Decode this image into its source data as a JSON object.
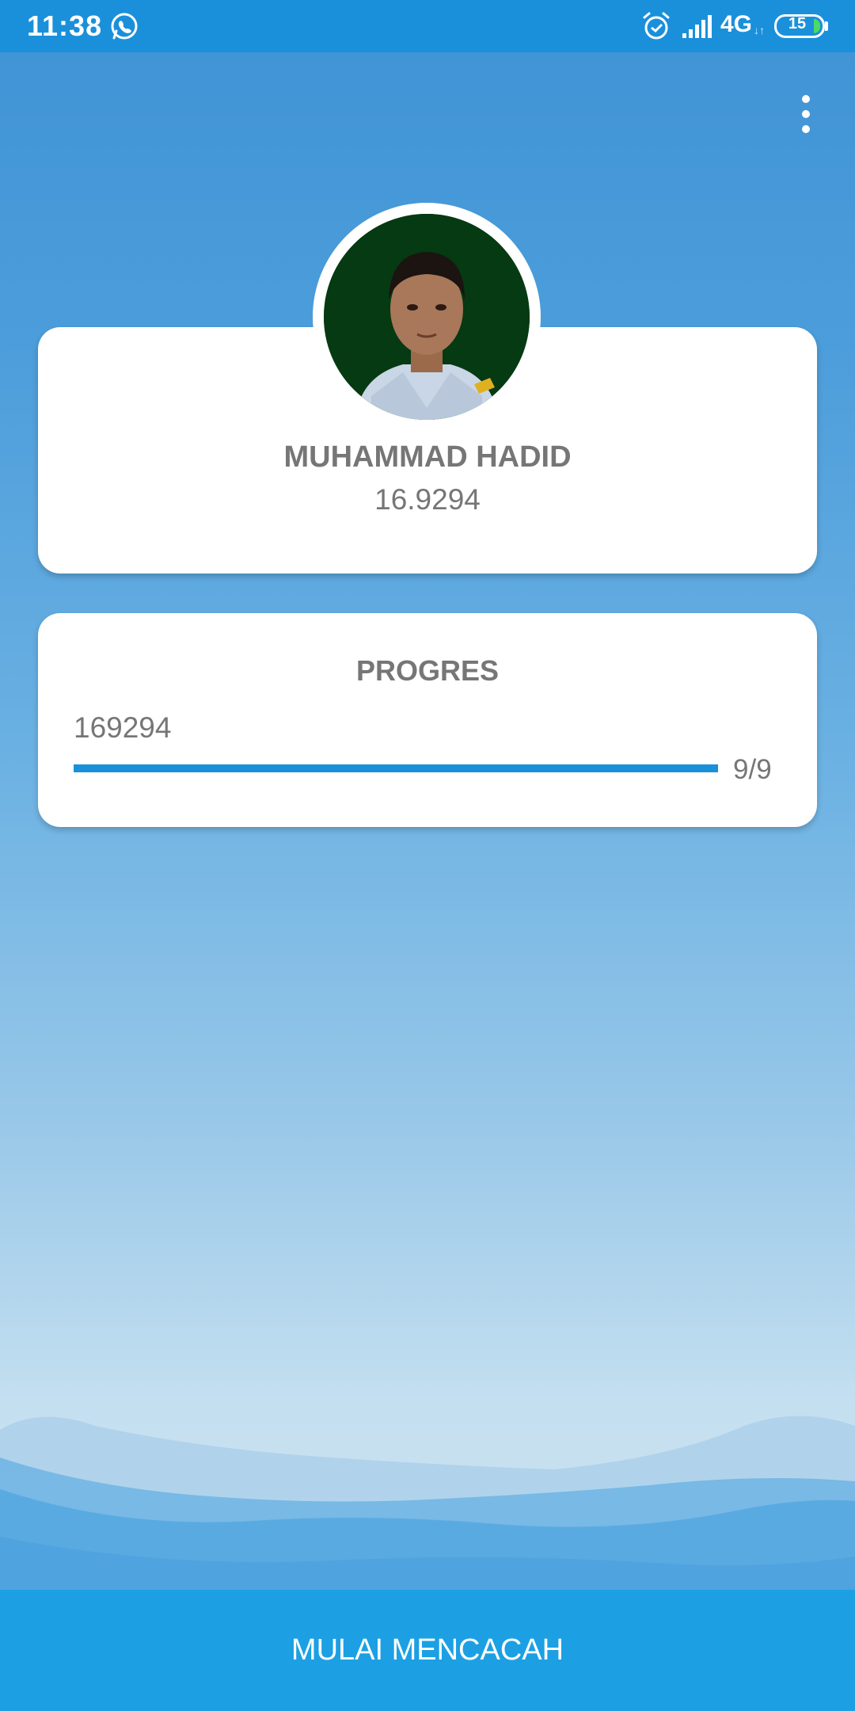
{
  "status_bar": {
    "time": "11:38",
    "network": "4G",
    "network_arrows": "↓↑",
    "battery_level": "15",
    "icons": [
      "whatsapp-icon",
      "alarm-icon",
      "signal-icon",
      "battery-icon"
    ]
  },
  "header": {
    "menu_icon": "more-vert-icon"
  },
  "profile": {
    "name": "MUHAMMAD HADID",
    "id": "16.9294"
  },
  "progress": {
    "title": "PROGRES",
    "code": "169294",
    "count": "9/9",
    "completed": 9,
    "total": 9
  },
  "actions": {
    "start_label": "MULAI MENCACAH"
  },
  "colors": {
    "primary": "#1a90db",
    "button": "#1ca0e3",
    "text_gray": "#767676"
  }
}
